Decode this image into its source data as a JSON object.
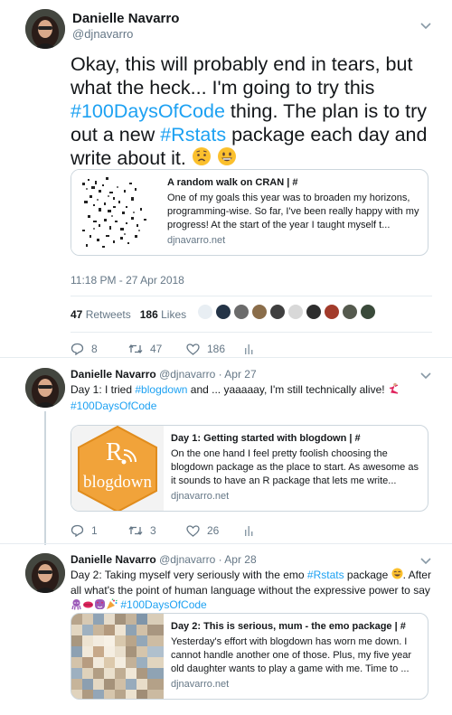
{
  "main_tweet": {
    "author_name": "Danielle Navarro",
    "author_handle": "@djnavarro",
    "text_1": "Okay, this will probably end in tears, but what the heck... I'm going to try this ",
    "hashtag_1": "#100DaysOfCode",
    "text_2": " thing. The plan is to try out a new ",
    "hashtag_2": "#Rstats",
    "text_3": " package each day and write about it. ",
    "card": {
      "title": "A random walk on CRAN | #",
      "description": "One of my goals this year was to broaden my horizons, programming-wise. So far, I've been really happy with my progress! At the start of the year I taught myself t...",
      "domain": "djnavarro.net"
    },
    "timestamp": "11:18 PM - 27 Apr 2018",
    "retweets_count": "47",
    "retweets_label": "Retweets",
    "likes_count": "186",
    "likes_label": "Likes",
    "actions": {
      "replies": "8",
      "retweets": "47",
      "likes": "186"
    }
  },
  "replies": [
    {
      "author_name": "Danielle Navarro",
      "author_handle": "@djnavarro",
      "date": "Apr 27",
      "text_1": "Day 1: I tried ",
      "hashtag_1": "#blogdown",
      "text_2": " and ... yaaaaay, I'm still technically alive! ",
      "hashtag_2": "#100DaysOfCode",
      "card": {
        "image_letter": "R",
        "image_label": "blogdown",
        "title": "Day 1: Getting started with blogdown | #",
        "description": "On the one hand I feel pretty foolish choosing the blogdown package as the place to start. As awesome as it sounds to have an R package that lets me write...",
        "domain": "djnavarro.net"
      },
      "actions": {
        "replies": "1",
        "retweets": "3",
        "likes": "26"
      }
    },
    {
      "author_name": "Danielle Navarro",
      "author_handle": "@djnavarro",
      "date": "Apr 28",
      "text_1": "Day 2: Taking myself very seriously with the emo ",
      "hashtag_1": "#Rstats",
      "text_2": " package ",
      "text_3": ". After all what's the point of human language without the expressive power to say ",
      "hashtag_2": "#100DaysOfCode",
      "card": {
        "title": "Day 2: This is serious, mum - the emo package | #",
        "description": "Yesterday's effort with blogdown has worn me down. I cannot handle another one of those. Plus, my five year old daughter wants to play a game with me. Time to ...",
        "domain": "djnavarro.net"
      }
    }
  ],
  "icons": [
    "chevron-down-icon",
    "reply-icon",
    "retweet-icon",
    "heart-icon",
    "analytics-icon",
    "worried-face-icon",
    "grinning-face-icon",
    "dancer-icon",
    "smiling-face-icon",
    "octopus-icon",
    "kiss-icon",
    "heart-eyes-icon",
    "party-popper-icon",
    "rss-icon"
  ],
  "colors": {
    "link": "#1da1f2",
    "muted": "#657786",
    "text": "#14171a",
    "blogdown_orange": "#f1a33a",
    "emoji_yellow": "#fbc02d"
  }
}
